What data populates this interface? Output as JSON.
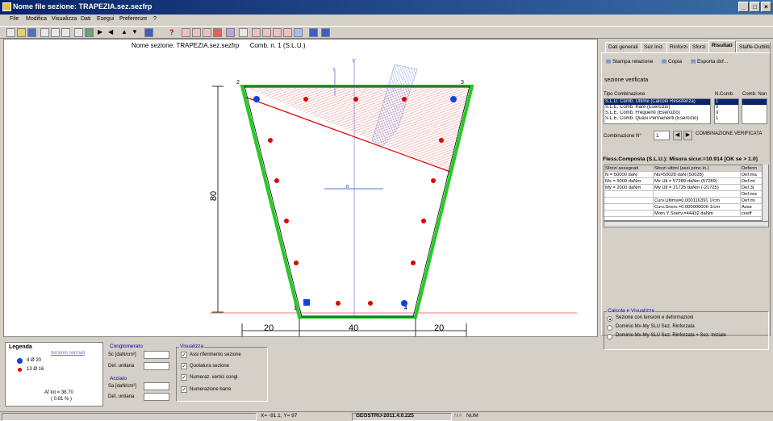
{
  "window": {
    "title": "Nome file sezione: TRAPEZIA.sez.sezfrp",
    "buttons": [
      "_",
      "□",
      "×"
    ]
  },
  "menu": [
    "File",
    "Modifica",
    "Visualizza",
    "Dati",
    "Esegui",
    "Preferenze",
    "?"
  ],
  "canvas": {
    "heading": "Nome sezione: TRAPEZIA.sez.sezfrp      Comb. n. 1 (S.L.U.)",
    "dim_height": "80",
    "dim_bottom": [
      "20",
      "40",
      "20"
    ],
    "vertex_labels": [
      "1",
      "2",
      "3",
      "4"
    ],
    "axis_y": "Y",
    "axis_b": "B",
    "small_y": "y"
  },
  "tabs": [
    "Dati generali",
    "Sez.Iniz.",
    "Rinforzi",
    "Sforzi",
    "Risultati",
    "Staffe-Duttilità"
  ],
  "active_tab": "Risultati",
  "results": {
    "buttons": [
      "Stampa relazione",
      "Copia",
      "Esporta dxf..."
    ],
    "status": "sezione verificata",
    "combo_headers": [
      "Tipo  Combinazione",
      "N.Comb.",
      "Comb. Non"
    ],
    "combos": [
      {
        "name": "S.L.U. Comb. Ultime (Calcolo Resistenza)",
        "n": "1"
      },
      {
        "name": "S.L.E. Comb. Rare (Esercizio)",
        "n": "0"
      },
      {
        "name": "S.L.E. Comb. Frequenti (Esercizio)",
        "n": "0"
      },
      {
        "name": "S.L.E. Comb. Quasi Permanenti (Esercizio)",
        "n": "1"
      }
    ],
    "comb_label": "Combinazione N°",
    "comb_value": "1",
    "comb_status": "COMBINAZIONE VERIFICATA",
    "flex_title": "Fless.Composta (S.L.U.): Misura sicur.=10.914 [OK se > 1.0]",
    "grid_headers": [
      "Sforzi assegnati",
      "Sforzi ultimi (assi princ.in.)",
      "Deform"
    ],
    "grid_rows": [
      [
        "N  = 50000 daN",
        "Nu=50028 daN (50028)",
        "Def.ma"
      ],
      [
        "Mx  = 5000 daNm",
        "Mx Ult = 57289 daNm (57289)",
        "Def.mi"
      ],
      [
        "My  = 2000 daNm",
        "My Ult = 21725 daNm (-21725)",
        "Def.3("
      ],
      [
        "",
        "",
        "Def.ma"
      ],
      [
        "",
        "Curv.Ultima=0.000116391 1/cm",
        "Def.mi"
      ],
      [
        "",
        "Curv.Snerv.=0.000000000 1/cm",
        "Asse"
      ],
      [
        "",
        "Mom.Y Snerv.=44432 daNm",
        "coeff"
      ]
    ],
    "calc_title": "Calcola e Visualizza",
    "calc_options": [
      "Sezione con tensioni e deformazioni",
      "Dominio Mx-My SLU Sez. Rinforzata",
      "Dominio Mx-My SLU Sez. Rinforzata + Sez. Iniziale"
    ]
  },
  "legend": {
    "title": "Legenda",
    "link": "tensioni normali",
    "bars": [
      {
        "label": "4 Ø 20",
        "color": "#1040e0"
      },
      {
        "label": "13 Ø 16",
        "color": "#e00000"
      }
    ],
    "af_tot": "Af tot = 38.70",
    "pct": "( 0.81 % )"
  },
  "concrete": {
    "title": "Conglomerato",
    "sc": "Sc [daN/cm²]",
    "def": "Def. unitaria"
  },
  "steel": {
    "title": "Acciaio",
    "sa": "Sa [daN/cm²]",
    "def": "Def. unitaria"
  },
  "visualizza": {
    "title": "Visualizza",
    "options": [
      "Assi riferimento sezione",
      "Quotatura sezione",
      "Numeraz. vertici congl.",
      "Numerazione barre"
    ]
  },
  "statusbar": {
    "coords": "X= -91.1;  Y=  97",
    "version": "GEOSTRU-2011.4.0.225",
    "ma": "MA",
    "num": "NUM"
  },
  "colors": {
    "green": "#22cc22",
    "red": "#e00000",
    "blue": "#1040e0",
    "hatch": "#e85050"
  }
}
